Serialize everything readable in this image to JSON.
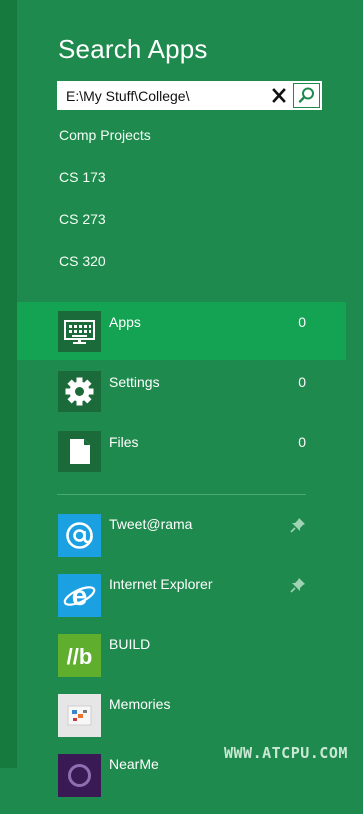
{
  "header": {
    "title": "Search Apps"
  },
  "search": {
    "query": "E:\\My Stuff\\College\\"
  },
  "suggestions": [
    {
      "label": "Comp Projects"
    },
    {
      "label": "CS 173"
    },
    {
      "label": "CS 273"
    },
    {
      "label": "CS 320"
    }
  ],
  "scopes": [
    {
      "label": "Apps",
      "count": "0",
      "icon": "keyboard-monitor-icon",
      "selected": true
    },
    {
      "label": "Settings",
      "count": "0",
      "icon": "gear-icon",
      "selected": false
    },
    {
      "label": "Files",
      "count": "0",
      "icon": "document-icon",
      "selected": false
    }
  ],
  "apps": [
    {
      "label": "Tweet@rama",
      "icon": "at-sign-icon",
      "tile_color": "#1ba1e2",
      "pinned": true
    },
    {
      "label": "Internet Explorer",
      "icon": "internet-explorer-icon",
      "tile_color": "#1ba1e2",
      "pinned": true
    },
    {
      "label": "BUILD",
      "icon": "build-logo-icon",
      "tile_color": "#5fae2e",
      "pinned": false
    },
    {
      "label": "Memories",
      "icon": "memories-icon",
      "tile_color": "#e6e6e6",
      "pinned": false
    },
    {
      "label": "NearMe",
      "icon": "nearme-icon",
      "tile_color": "#3a1a55",
      "pinned": false
    }
  ],
  "watermark": {
    "text": "WWW.ATCPU.COM"
  },
  "colors": {
    "background": "#1f8a4d",
    "selected": "#13a352",
    "tile_dark": "#1b6b3a",
    "edge": "#167a3f"
  }
}
